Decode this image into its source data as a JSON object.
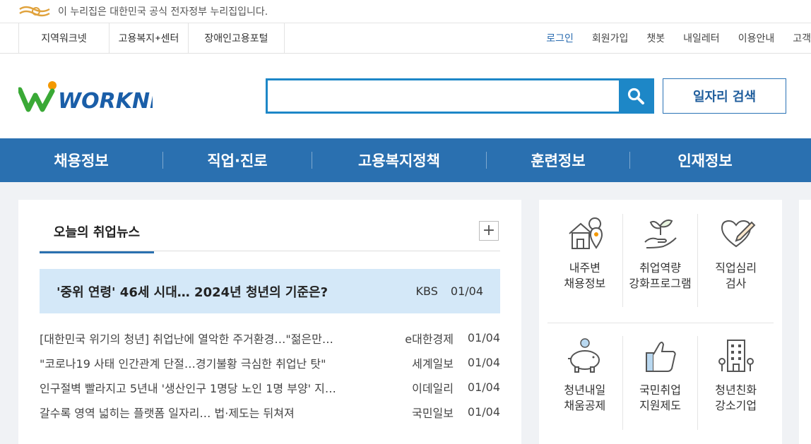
{
  "gov_banner": {
    "text": "이 누리집은 대한민국 공식 전자정부 누리집입니다.",
    "icon": "eg-government-logo"
  },
  "util_left": [
    {
      "label": "지역워크넷",
      "width": 128
    },
    {
      "label": "고용복지",
      "sup": "+",
      "suffix": "센터",
      "width": 112
    },
    {
      "label": "장애인고용포털",
      "width": 136
    }
  ],
  "util_right": [
    {
      "label": "로그인"
    },
    {
      "label": "회원가입"
    },
    {
      "label": "챗봇"
    },
    {
      "label": "내일레터"
    },
    {
      "label": "이용안내"
    },
    {
      "label": "고객"
    }
  ],
  "header": {
    "logo_text": "WORKNET",
    "search_placeholder": "",
    "job_search_label": "일자리 검색"
  },
  "main_nav": [
    "채용정보",
    "직업·진로",
    "고용복지정책",
    "훈련정보",
    "인재정보"
  ],
  "news": {
    "tab_label": "오늘의 취업뉴스",
    "more_label": "+",
    "headline": {
      "title": "'중위 연령' 46세 시대… 2024년 청년의 기준은?",
      "source": "KBS",
      "date": "01/04"
    },
    "items": [
      {
        "title": "[대한민국 위기의 청년] 취업난에 열악한 주거환경…\"젊은만…",
        "source": "e대한경제",
        "date": "01/04"
      },
      {
        "title": "\"코로나19 사태 인간관계 단절…경기불황 극심한 취업난 탓\"",
        "source": "세계일보",
        "date": "01/04"
      },
      {
        "title": "인구절벽 빨라지고 5년내 '생산인구 1명당 노인 1명 부양' 지…",
        "source": "이데일리",
        "date": "01/04"
      },
      {
        "title": "갈수록 영역 넓히는 플랫폼 일자리… 법·제도는 뒤쳐져",
        "source": "국민일보",
        "date": "01/04"
      }
    ]
  },
  "services": [
    {
      "label": "내주변\n채용정보",
      "icon": "house-location-icon"
    },
    {
      "label": "취업역량\n강화프로그램",
      "icon": "sprout-hand-icon"
    },
    {
      "label": "직업심리\n검사",
      "icon": "heart-pencil-icon"
    },
    {
      "label": "청년내일\n채움공제",
      "icon": "piggy-bank-icon"
    },
    {
      "label": "국민취업\n지원제도",
      "icon": "thumbs-up-icon"
    },
    {
      "label": "청년친화\n강소기업",
      "icon": "building-icon"
    }
  ],
  "colors": {
    "nav_blue": "#2a70b0",
    "search_blue": "#1d87c7",
    "headline_bg": "#d4e8f8",
    "logo_green": "#3aa936",
    "logo_orange": "#f39800",
    "logo_blue": "#1a5ea8"
  }
}
